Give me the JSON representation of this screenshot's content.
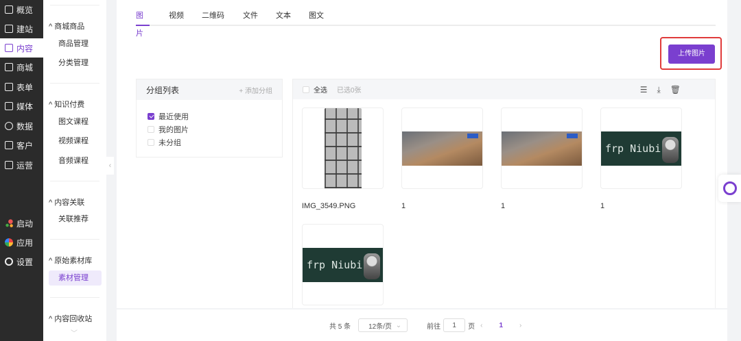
{
  "nav": [
    {
      "label": "概览",
      "icon": "monitor-icon"
    },
    {
      "label": "建站",
      "icon": "home-icon"
    },
    {
      "label": "内容",
      "icon": "document-icon",
      "active": true
    },
    {
      "label": "商城",
      "icon": "cart-icon"
    },
    {
      "label": "表单",
      "icon": "form-icon"
    },
    {
      "label": "媒体",
      "icon": "video-icon"
    },
    {
      "label": "数据",
      "icon": "pie-chart-icon"
    },
    {
      "label": "客户",
      "icon": "user-icon"
    },
    {
      "label": "运营",
      "icon": "paperclip-icon"
    },
    {
      "label": "启动",
      "icon": "launch-icon"
    },
    {
      "label": "应用",
      "icon": "apps-icon"
    },
    {
      "label": "设置",
      "icon": "gear-icon"
    }
  ],
  "submenu": {
    "groups": [
      {
        "title": "商城商品",
        "items": [
          "商品管理",
          "分类管理"
        ]
      },
      {
        "title": "知识付费",
        "items": [
          "图文课程",
          "视频课程",
          "音频课程"
        ]
      },
      {
        "title": "内容关联",
        "items": [
          "关联推荐"
        ]
      },
      {
        "title": "原始素材库",
        "items": [
          "素材管理"
        ]
      },
      {
        "title": "内容回收站",
        "items": []
      }
    ],
    "active": "素材管理"
  },
  "tabs": [
    "图片",
    "视频",
    "二维码",
    "文件",
    "文本",
    "图文"
  ],
  "upload_label": "上传图片",
  "groups": {
    "title": "分组列表",
    "add_label": "+ 添加分组",
    "items": [
      {
        "label": "最近使用",
        "checked": true
      },
      {
        "label": "我的图片",
        "checked": false
      },
      {
        "label": "未分组",
        "checked": false
      }
    ]
  },
  "images": {
    "select_all": "全选",
    "selected": "已选0张",
    "items": [
      {
        "name": "IMG_3549.PNG",
        "kind": "keyboard"
      },
      {
        "name": "1",
        "kind": "cart"
      },
      {
        "name": "1",
        "kind": "cart"
      },
      {
        "name": "1",
        "kind": "frp",
        "overlay": "frp Niubi"
      },
      {
        "name": "",
        "kind": "frp",
        "overlay": "frp Niubi"
      }
    ]
  },
  "pagination": {
    "total": "共 5 条",
    "page_size": "12条/页",
    "goto": "前往",
    "page_input": "1",
    "page_suffix": "页",
    "current": "1"
  },
  "colors": {
    "accent": "#7a3fcf",
    "sidebar": "#2b2b2b",
    "highlight": "#e03a3a"
  }
}
